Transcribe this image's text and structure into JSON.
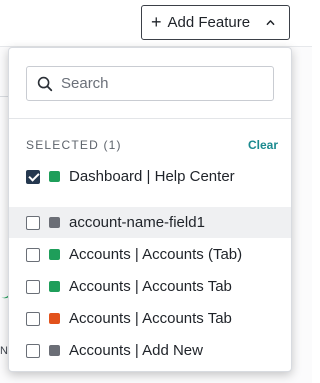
{
  "toolbar": {
    "add_feature_label": "Add Feature",
    "plus_glyph": "+",
    "chevron_icon": "chevron-up-icon"
  },
  "background": {
    "partial_text": "No"
  },
  "dropdown": {
    "search": {
      "placeholder": "Search",
      "value": "",
      "icon": "search-icon"
    },
    "selected_header": "SELECTED (1)",
    "clear_label": "Clear",
    "selected_items": [
      {
        "label": "Dashboard | Help Center",
        "color": "#1e9e5a",
        "checked": true
      }
    ],
    "items": [
      {
        "label": "account-name-field1",
        "color": "#6b6e76",
        "checked": false
      },
      {
        "label": "Accounts | Accounts (Tab)",
        "color": "#1e9e5a",
        "checked": false
      },
      {
        "label": "Accounts | Accounts Tab",
        "color": "#1e9e5a",
        "checked": false
      },
      {
        "label": "Accounts | Accounts Tab",
        "color": "#e2521b",
        "checked": false
      },
      {
        "label": "Accounts | Add New",
        "color": "#6b6e76",
        "checked": false
      }
    ]
  },
  "colors": {
    "accent": "#1b8a8f",
    "checkbox_checked": "#25384f",
    "hover_row": "#eff0f2"
  }
}
